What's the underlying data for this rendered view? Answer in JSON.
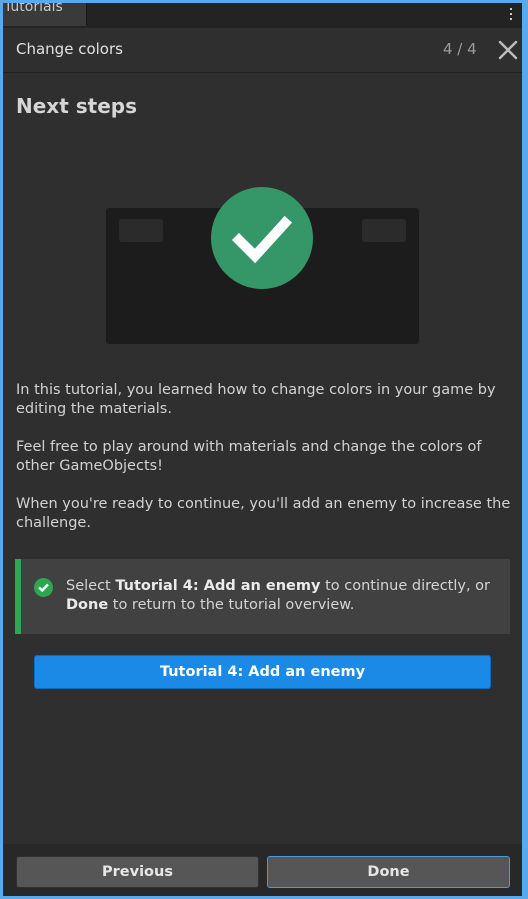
{
  "window": {
    "tab_label": "Tutorials",
    "menu_icon": "kebab-menu-icon"
  },
  "header": {
    "title": "Change colors",
    "progress": "4 / 4",
    "close_icon": "close-icon"
  },
  "content": {
    "section_title": "Next steps",
    "illustration_icon": "checkmark-circle-icon",
    "paragraphs": [
      "In this tutorial, you learned how to change colors in your game by editing the materials.",
      "Feel free to play around with materials and change the colors of other GameObjects!",
      "When you're ready to continue, you'll add an enemy to increase the challenge."
    ],
    "callout": {
      "icon": "check-circle-icon",
      "prefix": "Select ",
      "bold1": "Tutorial 4: Add an enemy",
      "middle": " to continue directly, or ",
      "bold2": "Done",
      "suffix": " to return to the tutorial overview."
    },
    "primary_button": "Tutorial 4: Add an enemy"
  },
  "footer": {
    "previous_label": "Previous",
    "done_label": "Done"
  },
  "colors": {
    "accent_blue": "#1a8ae6",
    "success_green": "#2fa652",
    "panel_bg": "#2f2f2f"
  }
}
